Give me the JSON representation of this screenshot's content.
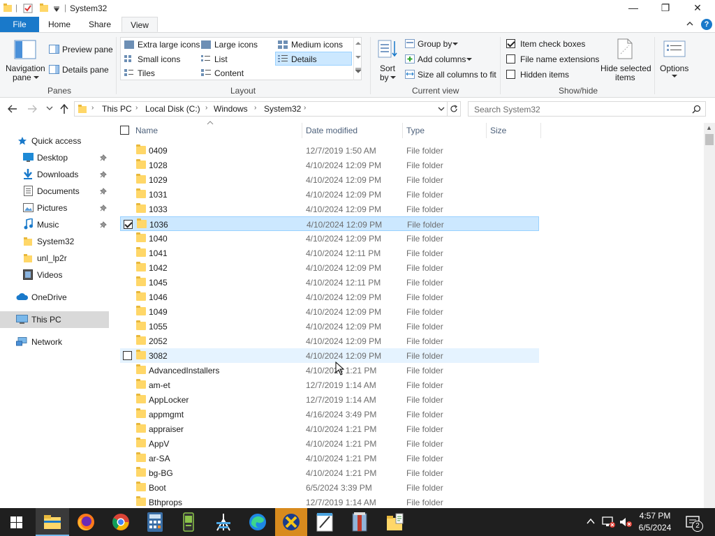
{
  "window": {
    "title": "System32",
    "minimize_glyph": "—",
    "maximize_glyph": "❐",
    "close_glyph": "✕"
  },
  "tabs": [
    {
      "label": "File"
    },
    {
      "label": "Home"
    },
    {
      "label": "Share"
    },
    {
      "label": "View"
    }
  ],
  "help_glyph": "?",
  "ribbon": {
    "panes": {
      "navigation_pane_line1": "Navigation",
      "navigation_pane_line2": "pane",
      "preview_pane": "Preview pane",
      "details_pane": "Details pane",
      "group_label": "Panes"
    },
    "layout": {
      "items": [
        "Extra large icons",
        "Large icons",
        "Medium icons",
        "Small icons",
        "List",
        "Details",
        "Tiles",
        "Content"
      ],
      "selected": "Details",
      "group_label": "Layout"
    },
    "current_view": {
      "sort_line1": "Sort",
      "sort_line2": "by",
      "group_by": "Group by",
      "add_columns": "Add columns",
      "size_all_columns": "Size all columns to fit",
      "group_label": "Current view"
    },
    "show_hide": {
      "item_check_boxes": "Item check boxes",
      "file_name_extensions": "File name extensions",
      "hidden_items": "Hidden items",
      "item_check_boxes_checked": true,
      "hide_selected_line1": "Hide selected",
      "hide_selected_line2": "items",
      "group_label": "Show/hide"
    },
    "options": {
      "label": "Options"
    }
  },
  "address": {
    "breadcrumb": [
      "This PC",
      "Local Disk (C:)",
      "Windows",
      "System32"
    ],
    "search_placeholder": "Search System32"
  },
  "nav_pane": [
    {
      "label": "Quick access",
      "icon": "star-icon"
    },
    {
      "label": "Desktop",
      "icon": "desktop-icon",
      "pinned": true
    },
    {
      "label": "Downloads",
      "icon": "download-icon",
      "pinned": true
    },
    {
      "label": "Documents",
      "icon": "document-icon",
      "pinned": true
    },
    {
      "label": "Pictures",
      "icon": "picture-icon",
      "pinned": true
    },
    {
      "label": "Music",
      "icon": "music-icon",
      "pinned": true
    },
    {
      "label": "System32",
      "icon": "folder-icon"
    },
    {
      "label": "unl_lp2r",
      "icon": "folder-icon"
    },
    {
      "label": "Videos",
      "icon": "video-icon"
    },
    {
      "label": "OneDrive",
      "icon": "cloud-icon"
    },
    {
      "label": "This PC",
      "icon": "computer-icon",
      "selected": true
    },
    {
      "label": "Network",
      "icon": "network-icon"
    }
  ],
  "columns": {
    "name": "Name",
    "date_modified": "Date modified",
    "type": "Type",
    "size": "Size"
  },
  "files": [
    {
      "name": "0409",
      "date": "12/7/2019 1:50 AM",
      "type": "File folder"
    },
    {
      "name": "1028",
      "date": "4/10/2024 12:09 PM",
      "type": "File folder"
    },
    {
      "name": "1029",
      "date": "4/10/2024 12:09 PM",
      "type": "File folder"
    },
    {
      "name": "1031",
      "date": "4/10/2024 12:09 PM",
      "type": "File folder"
    },
    {
      "name": "1033",
      "date": "4/10/2024 12:09 PM",
      "type": "File folder"
    },
    {
      "name": "1036",
      "date": "4/10/2024 12:09 PM",
      "type": "File folder",
      "selected": true
    },
    {
      "name": "1040",
      "date": "4/10/2024 12:09 PM",
      "type": "File folder"
    },
    {
      "name": "1041",
      "date": "4/10/2024 12:11 PM",
      "type": "File folder"
    },
    {
      "name": "1042",
      "date": "4/10/2024 12:09 PM",
      "type": "File folder"
    },
    {
      "name": "1045",
      "date": "4/10/2024 12:11 PM",
      "type": "File folder"
    },
    {
      "name": "1046",
      "date": "4/10/2024 12:09 PM",
      "type": "File folder"
    },
    {
      "name": "1049",
      "date": "4/10/2024 12:09 PM",
      "type": "File folder"
    },
    {
      "name": "1055",
      "date": "4/10/2024 12:09 PM",
      "type": "File folder"
    },
    {
      "name": "2052",
      "date": "4/10/2024 12:09 PM",
      "type": "File folder"
    },
    {
      "name": "3082",
      "date": "4/10/2024 12:09 PM",
      "type": "File folder",
      "hover": true
    },
    {
      "name": "AdvancedInstallers",
      "date": "4/10/2024 1:21 PM",
      "type": "File folder"
    },
    {
      "name": "am-et",
      "date": "12/7/2019 1:14 AM",
      "type": "File folder"
    },
    {
      "name": "AppLocker",
      "date": "12/7/2019 1:14 AM",
      "type": "File folder"
    },
    {
      "name": "appmgmt",
      "date": "4/16/2024 3:49 PM",
      "type": "File folder"
    },
    {
      "name": "appraiser",
      "date": "4/10/2024 1:21 PM",
      "type": "File folder"
    },
    {
      "name": "AppV",
      "date": "4/10/2024 1:21 PM",
      "type": "File folder"
    },
    {
      "name": "ar-SA",
      "date": "4/10/2024 1:21 PM",
      "type": "File folder"
    },
    {
      "name": "bg-BG",
      "date": "4/10/2024 1:21 PM",
      "type": "File folder"
    },
    {
      "name": "Boot",
      "date": "6/5/2024 3:39 PM",
      "type": "File folder"
    },
    {
      "name": "Bthprops",
      "date": "12/7/2019 1:14 AM",
      "type": "File folder"
    }
  ],
  "taskbar": {
    "apps": [
      "start-icon",
      "file-explorer-icon",
      "firefox-icon",
      "chrome-icon",
      "calculator-icon",
      "device-icon",
      "network-tool-icon",
      "edge-icon",
      "xampp-icon",
      "notepad-icon",
      "archive-icon",
      "folder-script-icon"
    ],
    "time": "4:57 PM",
    "date": "6/5/2024",
    "notification_count": "2",
    "caret_glyph": "^"
  },
  "colors": {
    "file_tab": "#1979ca",
    "selection": "#cce8ff",
    "accent": "#0078d7"
  }
}
